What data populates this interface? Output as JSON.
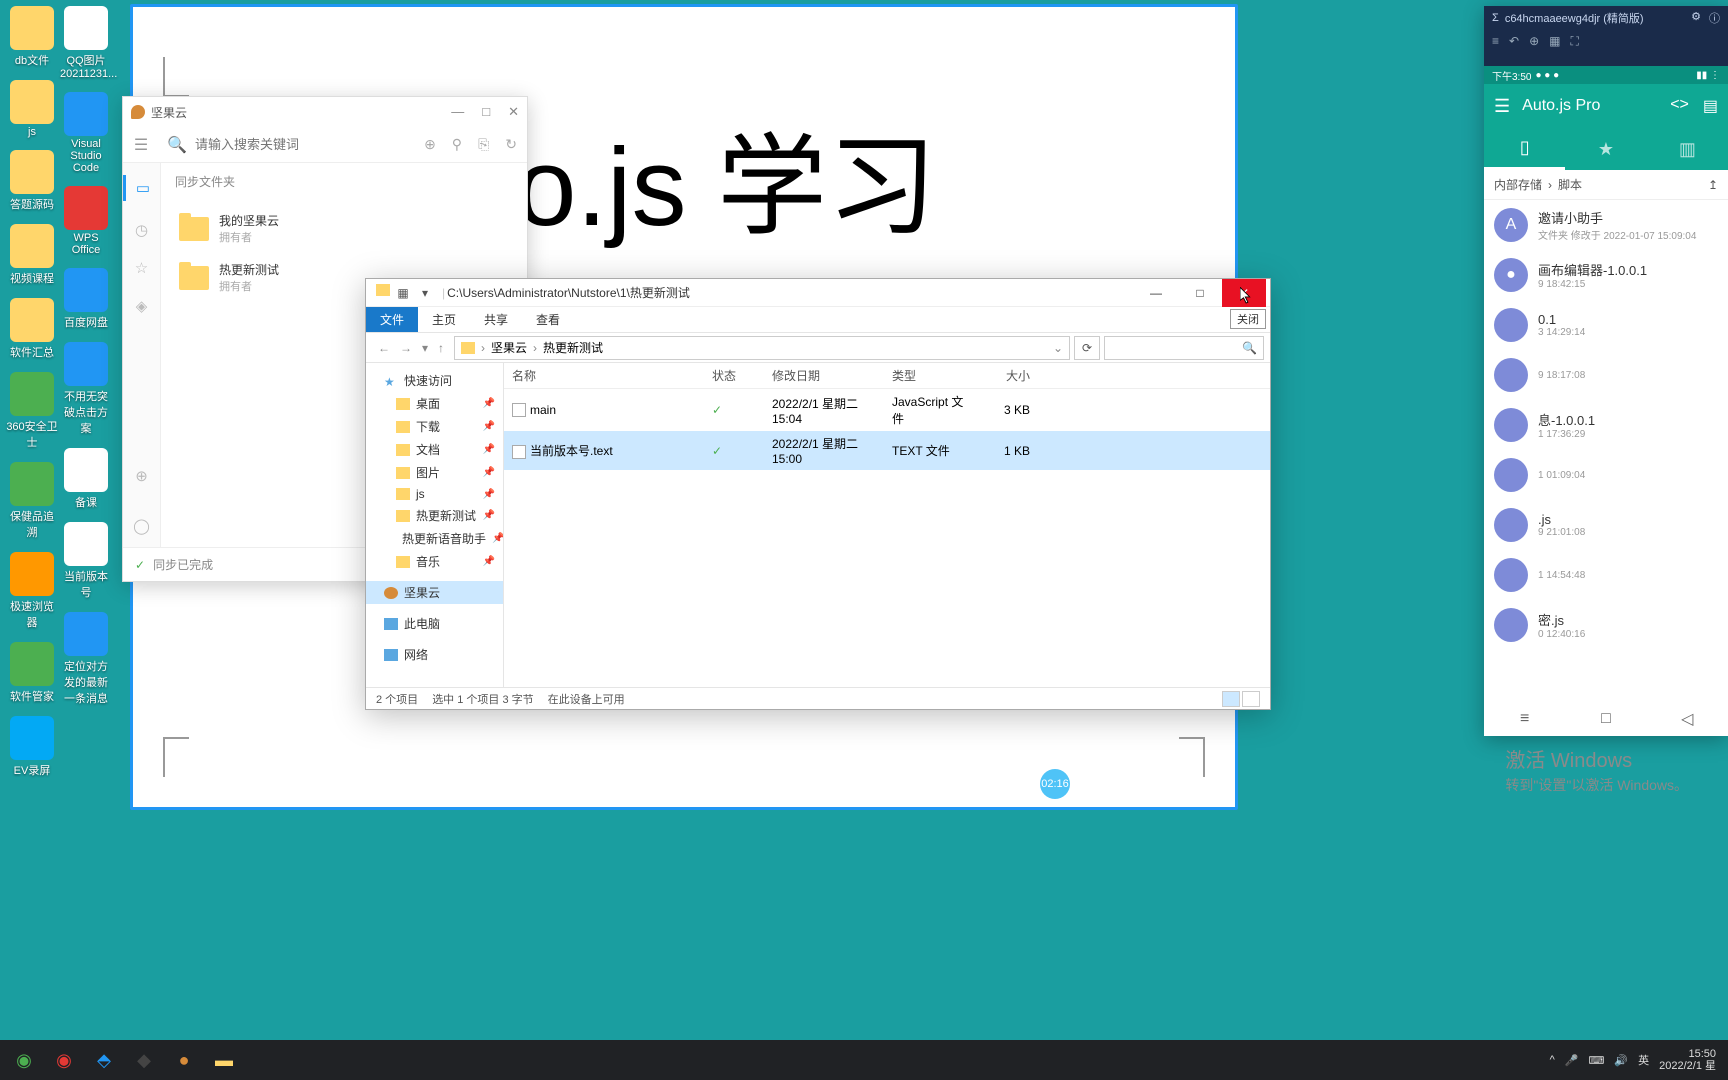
{
  "desktop": {
    "left_col": [
      {
        "label": "db文件",
        "color": "#ffd66b"
      },
      {
        "label": "js",
        "color": "#ffd66b"
      },
      {
        "label": "答题源码",
        "color": "#ffd66b"
      },
      {
        "label": "视频课程",
        "color": "#ffd66b"
      },
      {
        "label": "软件汇总",
        "color": "#ffd66b"
      },
      {
        "label": "360安全卫士",
        "color": "#4caf50"
      },
      {
        "label": "保健品追溯",
        "color": "#4caf50"
      },
      {
        "label": "极速浏览器",
        "color": "#ff9800"
      },
      {
        "label": "软件管家",
        "color": "#4caf50"
      },
      {
        "label": "EV录屏",
        "color": "#03a9f4"
      }
    ],
    "right_col": [
      {
        "label": "QQ图片20211231...",
        "color": "#fff"
      },
      {
        "label": "Visual Studio Code",
        "color": "#2196f3"
      },
      {
        "label": "WPS Office",
        "color": "#e53935"
      },
      {
        "label": "百度网盘",
        "color": "#2196f3"
      },
      {
        "label": "不用无突破点击方案",
        "color": "#2196f3"
      },
      {
        "label": "备课",
        "color": "#fff"
      },
      {
        "label": "当前版本号",
        "color": "#fff"
      },
      {
        "label": "定位对方发的最新一条消息",
        "color": "#2196f3"
      }
    ]
  },
  "whiteboard": {
    "title": "o.js 学习",
    "badge": "02:16"
  },
  "jianguoyun": {
    "title": "坚果云",
    "search_placeholder": "请输入搜索关键词",
    "section": "同步文件夹",
    "items": [
      {
        "name": "我的坚果云",
        "owner": "拥有者"
      },
      {
        "name": "热更新测试",
        "owner": "拥有者"
      }
    ],
    "footer": "同步已完成"
  },
  "explorer": {
    "path": "C:\\Users\\Administrator\\Nutstore\\1\\热更新测试",
    "tabs": [
      "文件",
      "主页",
      "共享",
      "查看"
    ],
    "breadcrumb": [
      "坚果云",
      "热更新测试"
    ],
    "tree": {
      "quick": "快速访问",
      "items": [
        "桌面",
        "下载",
        "文档",
        "图片",
        "js",
        "热更新测试",
        "热更新语音助手",
        "音乐"
      ],
      "nut": "坚果云",
      "pc": "此电脑",
      "net": "网络"
    },
    "columns": {
      "name": "名称",
      "status": "状态",
      "date": "修改日期",
      "type": "类型",
      "size": "大小"
    },
    "rows": [
      {
        "name": "main",
        "icon": "js",
        "status": "✓",
        "date": "2022/2/1 星期二 15:04",
        "type": "JavaScript 文件",
        "size": "3 KB",
        "sel": false
      },
      {
        "name": "当前版本号.text",
        "icon": "txt",
        "status": "✓",
        "date": "2022/2/1 星期二 15:00",
        "type": "TEXT 文件",
        "size": "1 KB",
        "sel": true
      }
    ],
    "status": {
      "count": "2 个项目",
      "selected": "选中 1 个项目  3 字节",
      "device": "在此设备上可用"
    },
    "close_tooltip": "关闭"
  },
  "emulator": {
    "title": "c64hcmaaeewg4djr (精简版)",
    "phone_time": "下午3:50",
    "app_title": "Auto.js Pro",
    "breadcrumb": {
      "root": "内部存储",
      "cur": "脚本"
    },
    "scripts": [
      {
        "name": "邀请小助手",
        "meta": "文件夹",
        "modified": "修改于 2022-01-07 15:09:04",
        "avatar": "A"
      },
      {
        "name": "画布编辑器-1.0.0.1",
        "meta": "",
        "modified": "9 18:42:15",
        "avatar": "●"
      },
      {
        "name": "0.1",
        "meta": "",
        "modified": "3 14:29:14",
        "avatar": ""
      },
      {
        "name": "",
        "meta": "",
        "modified": "9 18:17:08",
        "avatar": ""
      },
      {
        "name": "息-1.0.0.1",
        "meta": "",
        "modified": "1 17:36:29",
        "avatar": ""
      },
      {
        "name": "",
        "meta": "",
        "modified": "1 01:09:04",
        "avatar": ""
      },
      {
        "name": ".js",
        "meta": "",
        "modified": "9 21:01:08",
        "avatar": ""
      },
      {
        "name": "",
        "meta": "",
        "modified": "1 14:54:48",
        "avatar": ""
      },
      {
        "name": "密.js",
        "meta": "",
        "modified": "0 12:40:16",
        "avatar": ""
      }
    ]
  },
  "watermark": {
    "big": "激活 Windows",
    "small": "转到\"设置\"以激活 Windows。"
  },
  "taskbar": {
    "tray": {
      "ime": "英",
      "time": "15:50",
      "date": "2022/2/1 星"
    }
  }
}
